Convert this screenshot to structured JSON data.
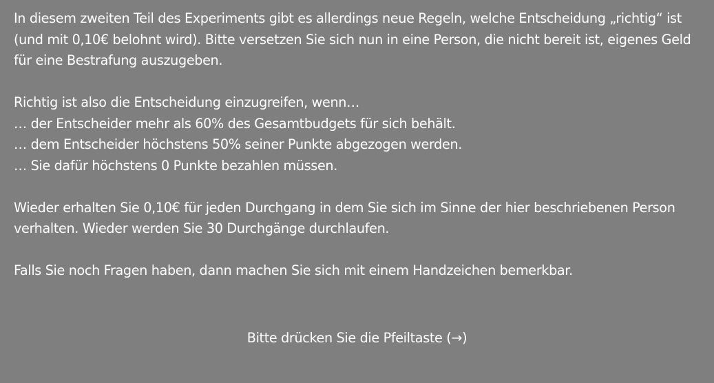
{
  "instructions": {
    "para1": "In diesem zweiten Teil des Experiments gibt es allerdings neue Regeln, welche Entscheidung „richtig“ ist (und mit 0,10€ belohnt wird). Bitte versetzen Sie sich nun in eine Person, die nicht bereit ist, eigenes Geld für eine Bestrafung auszugeben.",
    "rules_intro": "Richtig ist also die Entscheidung einzugreifen, wenn…",
    "rules": [
      "… der Entscheider mehr als 60% des Gesamtbudgets für sich behält.",
      "… dem Entscheider höchstens 50% seiner Punkte abgezogen werden.",
      "… Sie dafür höchstens 0 Punkte bezahlen müssen."
    ],
    "para3": "Wieder erhalten Sie 0,10€ für jeden Durchgang in dem Sie sich im Sinne der hier beschriebenen Person verhalten. Wieder werden Sie 30 Durchgänge durchlaufen.",
    "para4": "Falls Sie noch Fragen haben, dann machen Sie sich mit einem Handzeichen bemerkbar."
  },
  "prompt": "Bitte drücken Sie die Pfeiltaste (→)"
}
